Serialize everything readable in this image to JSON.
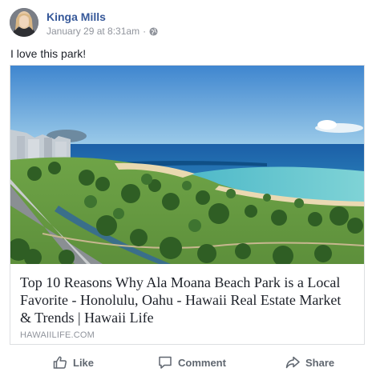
{
  "post": {
    "author": "Kinga Mills",
    "timestamp": "January 29 at 8:31am",
    "separator": "·",
    "privacy_icon": "globe-icon",
    "status_text": "I love this park!"
  },
  "link_card": {
    "image_description_icon": "beach-park-photo",
    "title": "Top 10 Reasons Why Ala Moana Beach Park is a Local Favorite - Honolulu, Oahu - Hawaii Real Estate Market & Trends | Hawaii Life",
    "domain": "HAWAIILIFE.COM"
  },
  "actions": {
    "like_label": "Like",
    "comment_label": "Comment",
    "share_label": "Share"
  },
  "colors": {
    "author_link": "#365899",
    "meta_gray": "#90949c",
    "action_gray": "#606770",
    "border": "#dddfe2"
  }
}
